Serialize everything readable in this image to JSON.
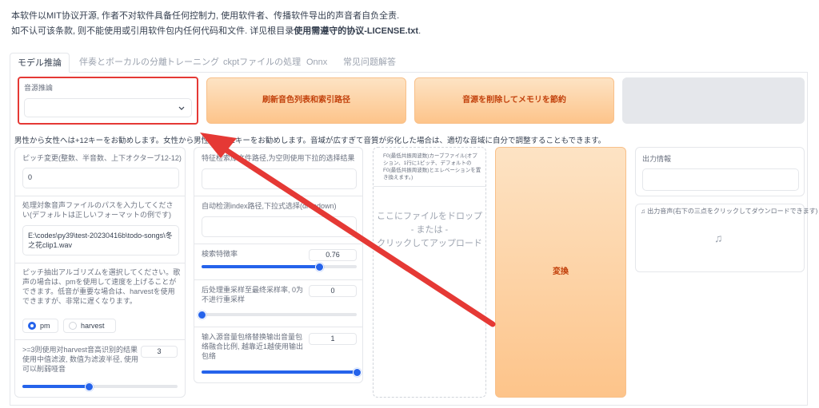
{
  "notice": {
    "line1": "本软件以MIT协议开源, 作者不对软件具备任何控制力, 使用软件者、传播软件导出的声音者自负全责.",
    "line2_prefix": "如不认可该条款, 则不能使用或引用软件包内任何代码和文件. 详见根目录",
    "line2_bold": "使用需遵守的协议-LICENSE.txt",
    "line2_suffix": "."
  },
  "tabs": [
    {
      "label": "モデル推論",
      "active": true
    },
    {
      "label": "伴奏とボーカルの分離",
      "active": false
    },
    {
      "label": "トレーニング",
      "active": false
    },
    {
      "label": "ckptファイルの処理",
      "active": false
    },
    {
      "label": "Onnx",
      "active": false
    },
    {
      "label": "常见问题解答",
      "active": false
    }
  ],
  "voice_select": {
    "label": "音源推論",
    "value": ""
  },
  "buttons": {
    "refresh": "刷新音色列表和索引路径",
    "unload": "音源を削除してメモリを節約",
    "convert": "変換"
  },
  "key_hint": "男性から女性へは+12キーをお勧めします。女性から男性へは-12キーをお勧めします。音域が広すぎて音質が劣化した場合は、適切な音域に自分で調整することもできます。",
  "pitch": {
    "label": "ピッチ変更(整数、半音数、上下オクターブ12-12)",
    "value": "0"
  },
  "input_path": {
    "label": "処理対象音声ファイルのパスを入力してください(デフォルトは正しいフォーマットの例です)",
    "value": "E:\\codes\\py39\\test-20230416b\\todo-songs\\冬之花clip1.wav"
  },
  "f0_method": {
    "label": "ピッチ抽出アルゴリズムを選択してください。歌声の場合は、pmを使用して速度を上げることができます。低音が重要な場合は、harvestを使用できますが、非常に遅くなります。",
    "options": [
      "pm",
      "harvest"
    ],
    "selected": "pm"
  },
  "filter_radius": {
    "label": ">=3则使用对harvest音高识别的结果使用中值滤波, 数值为滤波半径, 使用可以削弱哑音",
    "value": "3",
    "fraction": 0.43
  },
  "feature_index": {
    "label": "特征检索库文件路径,为空则使用下拉的选择结果",
    "value": ""
  },
  "auto_index": {
    "label": "自动检测index路径,下拉式选择(dropdown)",
    "value": ""
  },
  "index_ratio": {
    "label": "検索特徴率",
    "value": "0.76",
    "fraction": 0.76
  },
  "resample": {
    "label": "后处理重采样至最终采样率, 0为不进行重采样",
    "value": "0",
    "fraction": 0.0
  },
  "rms_mix": {
    "label": "输入源音量包络替换输出音量包络融合比例, 越靠近1越使用输出包络",
    "value": "1",
    "fraction": 1.0
  },
  "f0_file": {
    "label": "F0(最低共振周波数)カーブファイル(オプション、1行に1ピッチ、デフォルトのF0(最低共振周波数)とエレベーションを置き換えます。)"
  },
  "dropzone": {
    "line1": "ここにファイルをドロップ",
    "line2": "- または -",
    "line3": "クリックしてアップロード"
  },
  "output_info": {
    "label": "出力情報",
    "value": ""
  },
  "output_audio": {
    "label": "出力音声(右下の三点をクリックしてダウンロードできます)"
  },
  "colors": {
    "accent_orange": "#fdc48a",
    "accent_blue": "#2563eb",
    "highlight_red": "#e53935"
  }
}
